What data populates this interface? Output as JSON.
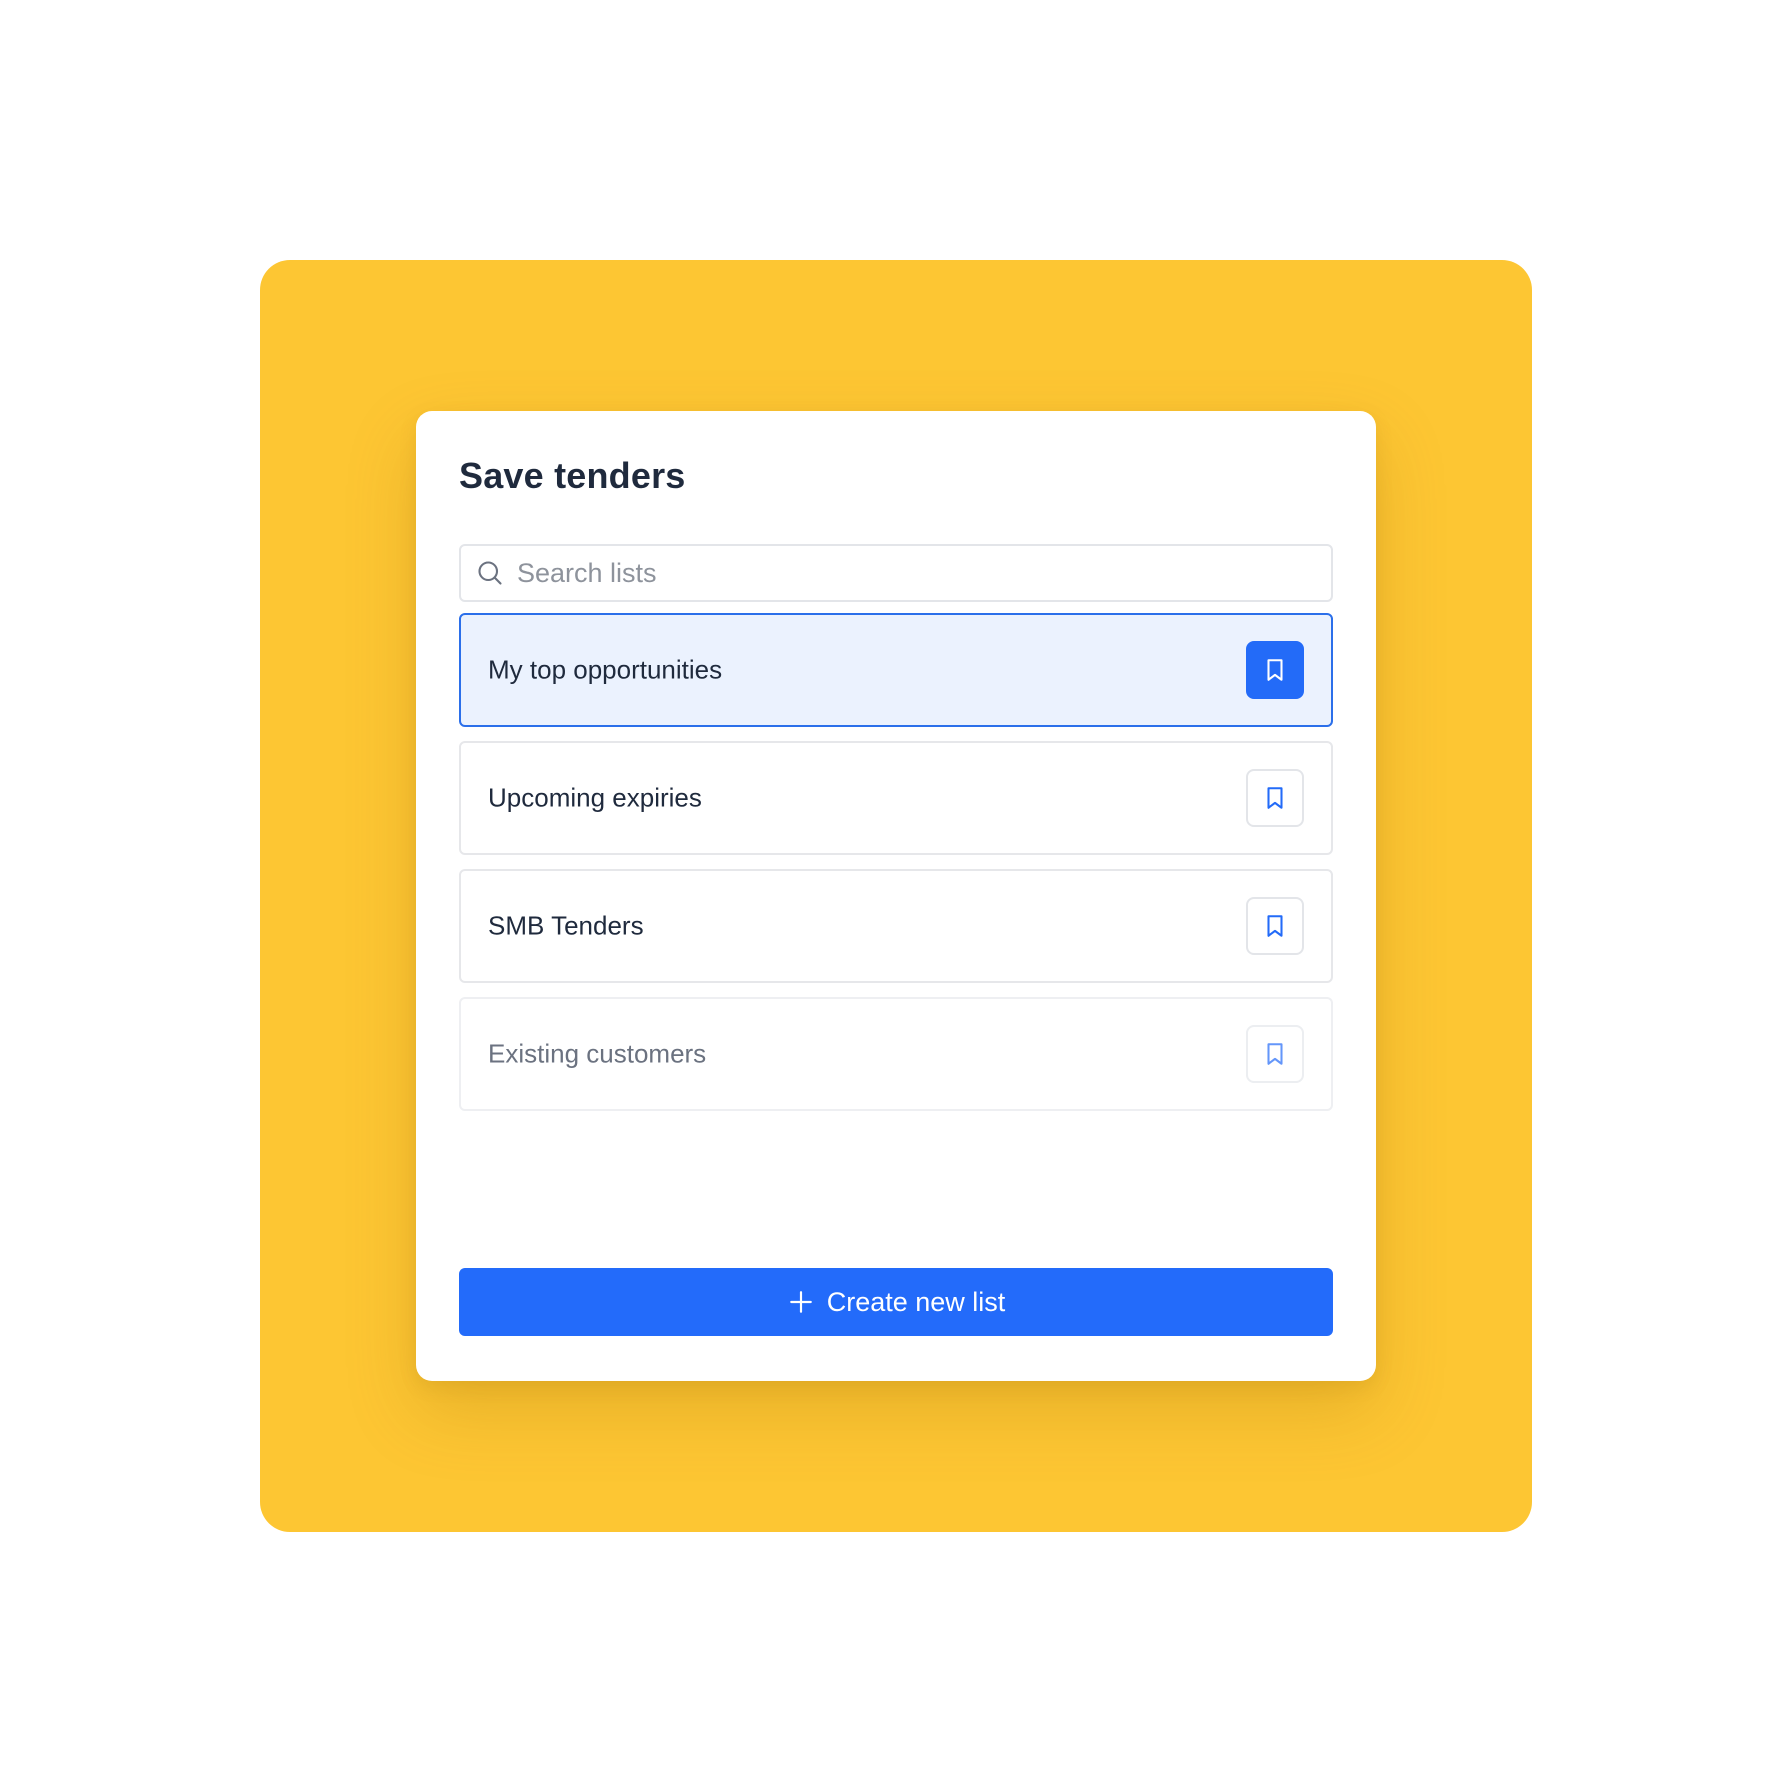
{
  "dialog": {
    "title": "Save tenders"
  },
  "search": {
    "placeholder": "Search lists",
    "value": ""
  },
  "lists": [
    {
      "label": "My top opportunities",
      "selected": true
    },
    {
      "label": "Upcoming expiries",
      "selected": false
    },
    {
      "label": "SMB Tenders",
      "selected": false
    },
    {
      "label": "Existing customers",
      "selected": false
    }
  ],
  "actions": {
    "create_label": "Create new list"
  },
  "colors": {
    "background": "#fdc633",
    "accent": "#236bfa",
    "selected_bg": "#ebf2fe",
    "text": "#1f2a3d"
  },
  "icons": {
    "search": "search-icon",
    "bookmark": "bookmark-icon",
    "plus": "plus-icon"
  }
}
